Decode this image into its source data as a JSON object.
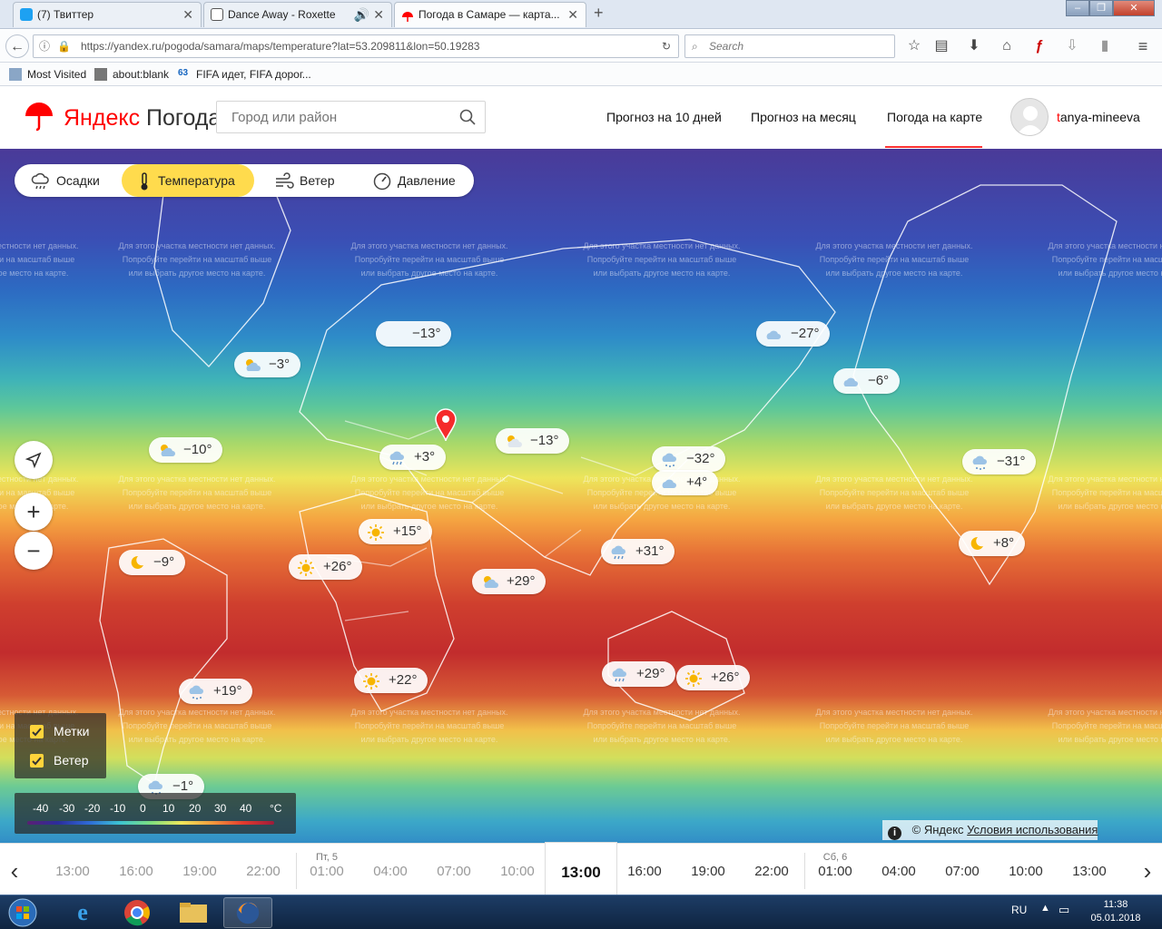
{
  "browser": {
    "tabs": [
      {
        "label": "(7) Твиттер"
      },
      {
        "label": "Dance Away - Roxette"
      },
      {
        "label": "Погода в Самаре — карта..."
      }
    ],
    "url": "https://yandex.ru/pogoda/samara/maps/temperature?lat=53.209811&lon=50.19283",
    "search_placeholder": "Search",
    "bookmarks": [
      {
        "label": "Most Visited"
      },
      {
        "label": "about:blank"
      },
      {
        "label": "FIFA идет, FIFA дорог..."
      }
    ]
  },
  "header": {
    "logo_ya": "Яндекс",
    "logo_rest": "Погода",
    "city_placeholder": "Город или район",
    "nav": [
      "Прогноз на 10 дней",
      "Прогноз на месяц",
      "Погода на карте"
    ],
    "active_nav": "Погода на карте",
    "user_first_letter": "t",
    "user_rest": "anya-mineeva"
  },
  "layers": [
    {
      "label": "Осадки",
      "icon": "rain-cloud-icon"
    },
    {
      "label": "Температура",
      "icon": "thermometer-icon",
      "active": true
    },
    {
      "label": "Ветер",
      "icon": "wind-icon"
    },
    {
      "label": "Давление",
      "icon": "pressure-gauge-icon"
    }
  ],
  "no_data_message": {
    "line1": "Для этого участка местности нет данных.",
    "line2": "Попробуйте перейти на масштаб выше",
    "line3": "или выбрать другое место на карте."
  },
  "pins": [
    {
      "temp": "−13°",
      "icon": "none"
    },
    {
      "temp": "−3°",
      "icon": "sun-cloud-icon"
    },
    {
      "temp": "−27°",
      "icon": "cloud-icon"
    },
    {
      "temp": "−6°",
      "icon": "cloud-icon"
    },
    {
      "temp": "−10°",
      "icon": "sun-cloud-icon"
    },
    {
      "temp": "+3°",
      "icon": "rain-cloud-icon"
    },
    {
      "temp": "−13°",
      "icon": "sun-cloud-icon"
    },
    {
      "temp": "−32°",
      "icon": "snow-cloud-icon"
    },
    {
      "temp": "+4°",
      "icon": "cloud-icon"
    },
    {
      "temp": "−31°",
      "icon": "snow-cloud-icon"
    },
    {
      "temp": "+15°",
      "icon": "sun-icon"
    },
    {
      "temp": "+8°",
      "icon": "moon-icon"
    },
    {
      "temp": "−9°",
      "icon": "moon-icon"
    },
    {
      "temp": "+31°",
      "icon": "rain-cloud-icon"
    },
    {
      "temp": "+26°",
      "icon": "sun-icon"
    },
    {
      "temp": "+29°",
      "icon": "sun-cloud-icon"
    },
    {
      "temp": "+19°",
      "icon": "snow-cloud-icon"
    },
    {
      "temp": "+22°",
      "icon": "sun-icon"
    },
    {
      "temp": "+29°",
      "icon": "rain-cloud-icon"
    },
    {
      "temp": "+26°",
      "icon": "sun-icon"
    },
    {
      "temp": "−1°",
      "icon": "snow-cloud-icon"
    }
  ],
  "legend": {
    "labels_checkbox": "Метки",
    "wind_checkbox": "Ветер",
    "scale_ticks": [
      "-40",
      "-30",
      "-20",
      "-10",
      "0",
      "10",
      "20",
      "30",
      "40"
    ],
    "scale_unit": "°C"
  },
  "copyright": {
    "text": "© Яндекс",
    "link": "Условия использования"
  },
  "timeline": {
    "slots": [
      {
        "time": "13:00",
        "state": "past"
      },
      {
        "time": "16:00",
        "state": "past"
      },
      {
        "time": "19:00",
        "state": "past"
      },
      {
        "time": "22:00",
        "state": "past"
      },
      {
        "time": "01:00",
        "state": "past",
        "day": "Пт, 5"
      },
      {
        "time": "04:00",
        "state": "past"
      },
      {
        "time": "07:00",
        "state": "past"
      },
      {
        "time": "10:00",
        "state": "past"
      },
      {
        "time": "13:00",
        "state": "current"
      },
      {
        "time": "16:00",
        "state": "future"
      },
      {
        "time": "19:00",
        "state": "future"
      },
      {
        "time": "22:00",
        "state": "future"
      },
      {
        "time": "01:00",
        "state": "future",
        "day": "Сб, 6"
      },
      {
        "time": "04:00",
        "state": "future"
      },
      {
        "time": "07:00",
        "state": "future"
      },
      {
        "time": "10:00",
        "state": "future"
      },
      {
        "time": "13:00",
        "state": "future"
      }
    ]
  },
  "taskbar": {
    "lang": "RU",
    "time": "11:38",
    "date": "05.01.2018"
  }
}
